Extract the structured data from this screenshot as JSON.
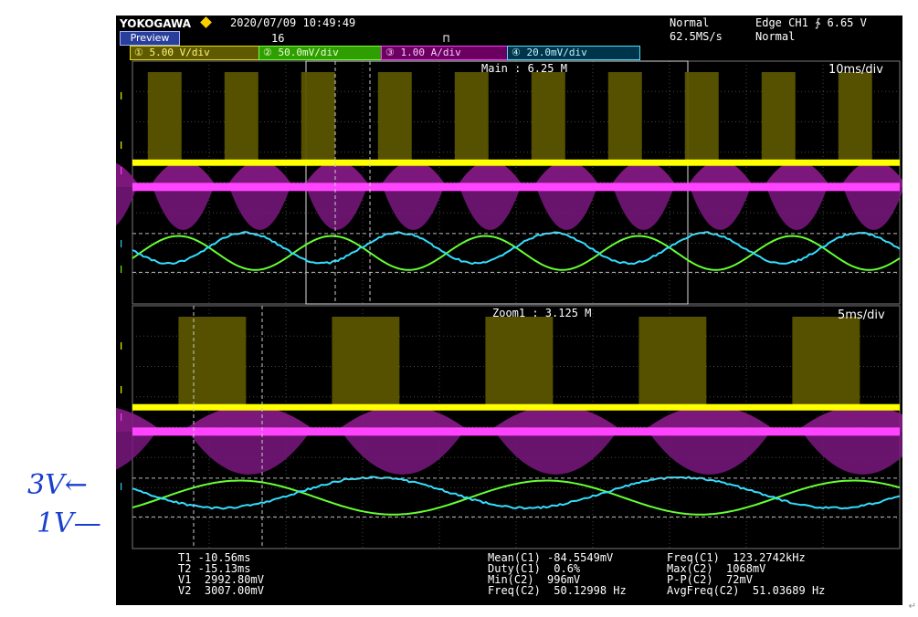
{
  "header": {
    "brand": "YOKOGAWA",
    "datetime": "2020/07/09 10:49:49",
    "preview_label": "Preview",
    "acq_count": "16",
    "mode": "Normal",
    "sample_rate": "62.5MS/s",
    "trigger_type": "Edge CH1 ∱ 6.65 V",
    "trigger_mode": "Normal"
  },
  "channels": [
    {
      "label": "① 5.00 V/div",
      "color": "#ffff00"
    },
    {
      "label": "② 50.0mV/div",
      "color": "#66ff33"
    },
    {
      "label": "③ 1.00 A/div",
      "color": "#ff33ff"
    },
    {
      "label": "④ 20.0mV/div",
      "color": "#33ddff"
    }
  ],
  "main_window": {
    "label": "Main : 6.25 M",
    "timebase": "10ms/div"
  },
  "zoom_window": {
    "label": "Zoom1 : 3.125 M",
    "timebase": "5ms/div"
  },
  "cursor_readout": {
    "t1": "T1 -10.56ms",
    "t2": "T2 -15.13ms",
    "v1": "V1  2992.80mV",
    "v2": "V2  3007.00mV"
  },
  "measurements_mid": {
    "mean": "Mean(C1) -84.5549mV",
    "duty": "Duty(C1)  0.6%",
    "min": "Min(C2)  996mV",
    "freq": "Freq(C2)  50.12998 Hz"
  },
  "measurements_right": {
    "freq": "Freq(C1)  123.2742kHz",
    "max": "Max(C2)  1068mV",
    "pp": "P-P(C2)  72mV",
    "avgfreq": "AvgFreq(C2)  51.03689 Hz"
  },
  "annotations": {
    "label_3v": "3V←",
    "label_1v": "1V—"
  }
}
